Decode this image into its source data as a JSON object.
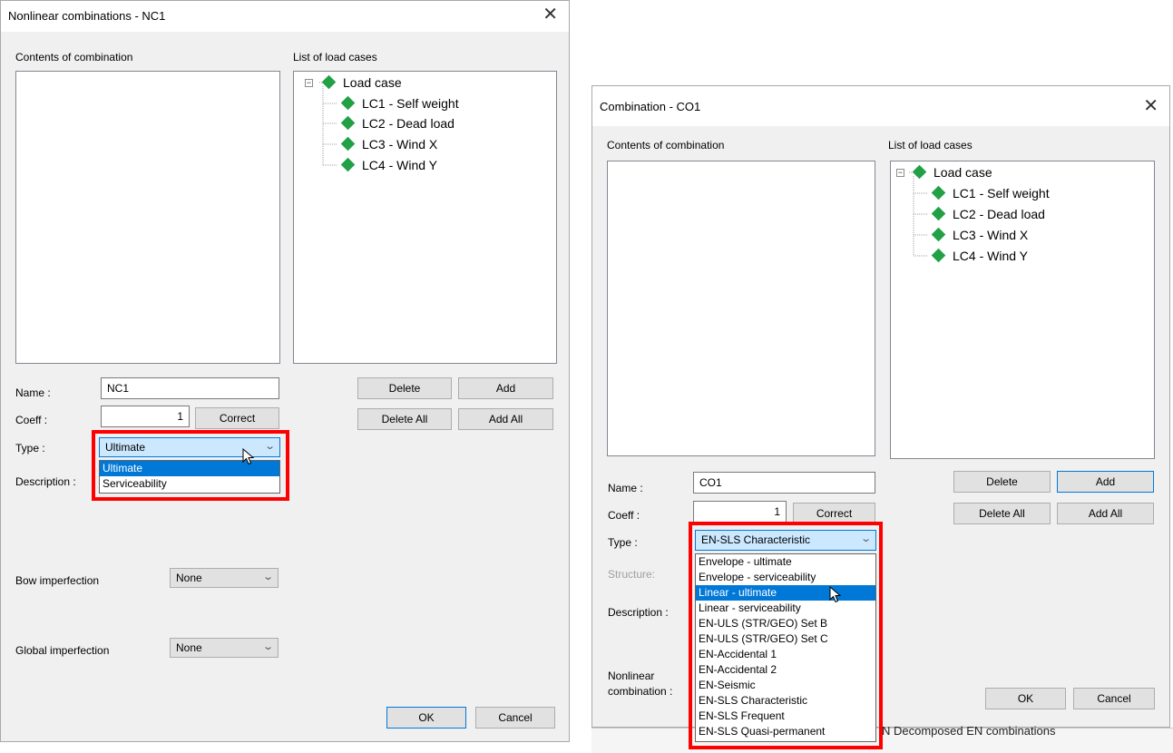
{
  "left_dialog": {
    "title": "Nonlinear combinations - NC1",
    "contents_label": "Contents of combination",
    "list_label": "List of load cases",
    "tree": {
      "root": "Load case",
      "items": [
        "LC1 - Self weight",
        "LC2 - Dead load",
        "LC3 - Wind X",
        "LC4 - Wind Y"
      ]
    },
    "name_label": "Name :",
    "name_value": "NC1",
    "coeff_label": "Coeff :",
    "coeff_value": "1",
    "correct_label": "Correct",
    "delete_label": "Delete",
    "add_label": "Add",
    "delete_all_label": "Delete All",
    "add_all_label": "Add All",
    "type_label": "Type :",
    "type_value": "Ultimate",
    "type_options": [
      "Ultimate",
      "Serviceability"
    ],
    "type_selected_index": 0,
    "description_label": "Description :",
    "bow_label": "Bow imperfection",
    "bow_value": "None",
    "global_label": "Global imperfection",
    "global_value": "None",
    "ok_label": "OK",
    "cancel_label": "Cancel"
  },
  "right_dialog": {
    "title": "Combination - CO1",
    "contents_label": "Contents of combination",
    "list_label": "List of load cases",
    "tree": {
      "root": "Load case",
      "items": [
        "LC1 - Self weight",
        "LC2 - Dead load",
        "LC3 - Wind X",
        "LC4 - Wind Y"
      ]
    },
    "name_label": "Name :",
    "name_value": "CO1",
    "coeff_label": "Coeff :",
    "coeff_value": "1",
    "correct_label": "Correct",
    "delete_label": "Delete",
    "add_label": "Add",
    "delete_all_label": "Delete All",
    "add_all_label": "Add All",
    "type_label": "Type :",
    "type_value": "EN-SLS Characteristic",
    "type_options": [
      "Envelope - ultimate",
      "Envelope - serviceability",
      "Linear - ultimate",
      "Linear - serviceability",
      "EN-ULS (STR/GEO) Set B",
      "EN-ULS (STR/GEO) Set C",
      "EN-Accidental 1",
      "EN-Accidental 2",
      "EN-Seismic",
      "EN-SLS Characteristic",
      "EN-SLS Frequent",
      "EN-SLS Quasi-permanent"
    ],
    "type_selected_index": 2,
    "structure_label": "Structure:",
    "description_label": "Description :",
    "nonlinear_label_1": "Nonlinear",
    "nonlinear_label_2": "combination :",
    "ok_label": "OK",
    "cancel_label": "Cancel",
    "background_text": "N Decomposed EN combinations"
  },
  "colors": {
    "dialog_bg": "#f0f0f0",
    "highlight": "#ff0000",
    "selection": "#0078d7",
    "load_case_icon": "#22a046"
  }
}
